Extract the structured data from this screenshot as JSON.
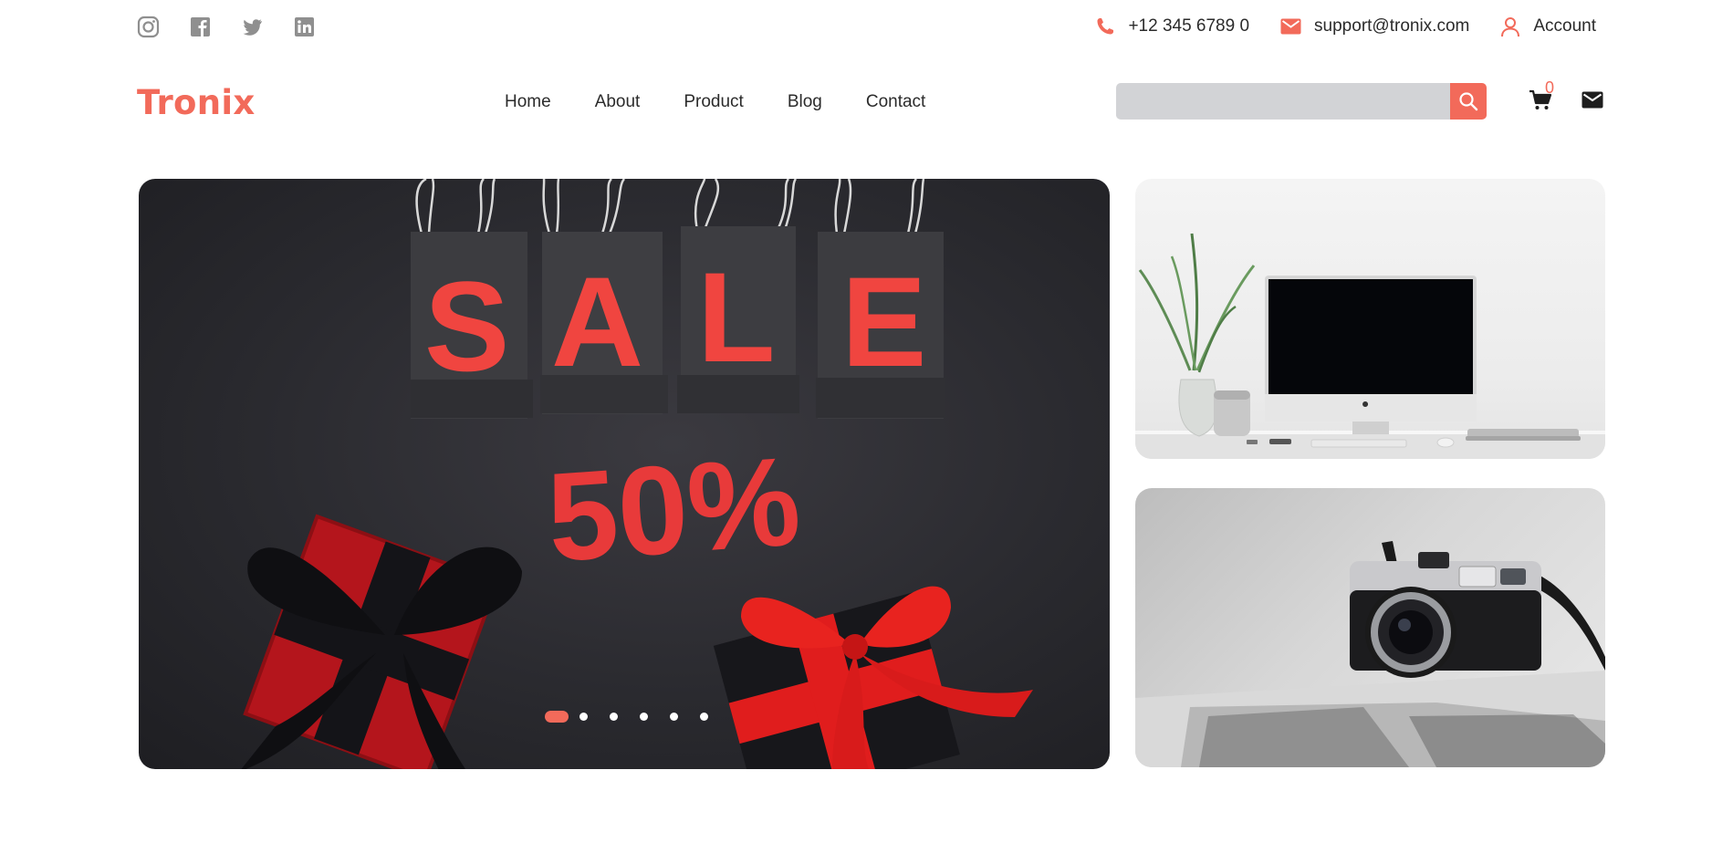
{
  "topbar": {
    "socials": [
      {
        "icon": "instagram-icon"
      },
      {
        "icon": "facebook-icon"
      },
      {
        "icon": "twitter-icon"
      },
      {
        "icon": "linkedin-icon"
      }
    ],
    "phone": "+12 345 6789 0",
    "email": "support@tronix.com",
    "account": "Account"
  },
  "header": {
    "logo": "Tronix",
    "nav": [
      "Home",
      "About",
      "Product",
      "Blog",
      "Contact"
    ],
    "search_placeholder": "",
    "cart_count": "0"
  },
  "hero": {
    "sale_letters": [
      "S",
      "A",
      "L",
      "E"
    ],
    "discount": "50%",
    "slides": 6,
    "active_slide": 1
  },
  "colors": {
    "accent": "#f26a5a",
    "text": "#2b2b2b",
    "icon_grey": "#8f8f8f",
    "search_bg": "#d2d3d6"
  }
}
